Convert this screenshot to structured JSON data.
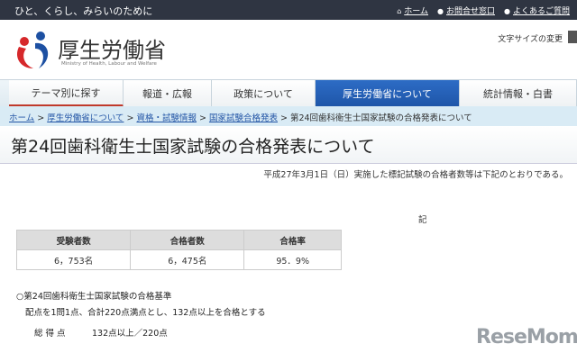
{
  "topbar": {
    "tagline": "ひと、くらし、みらいのために",
    "links": [
      "ホーム",
      "お問合せ窓口",
      "よくあるご質問"
    ]
  },
  "header": {
    "logo_text": "厚生労働省",
    "logo_sub": "Ministry of Health, Labour and Welfare",
    "font_size_label": "文字サイズの変更"
  },
  "nav": [
    "テーマ別に探す",
    "報道・広報",
    "政策について",
    "厚生労働省について",
    "統計情報・白書"
  ],
  "breadcrumb": {
    "links": [
      "ホーム",
      "厚生労働省について",
      "資格・試験情報",
      "国家試験合格発表"
    ],
    "current": "第24回歯科衛生士国家試験の合格発表について",
    "sep": " > "
  },
  "title": "第24回歯科衛生士国家試験の合格発表について",
  "lead": "平成27年3月1日（日）実施した標記試験の合格者数等は下記のとおりである。",
  "ki": "記",
  "table": {
    "headers": [
      "受験者数",
      "合格者数",
      "合格率"
    ],
    "row": [
      "6，753名",
      "6，475名",
      "95．9%"
    ]
  },
  "criteria": {
    "heading": "○第24回歯科衛生士国家試験の合格基準",
    "desc": "配点を1問1点、合計220点満点とし、132点以上を合格とする",
    "score_label": "総 得 点",
    "score_value": "132点以上／220点"
  },
  "watermark": "ReseMom"
}
